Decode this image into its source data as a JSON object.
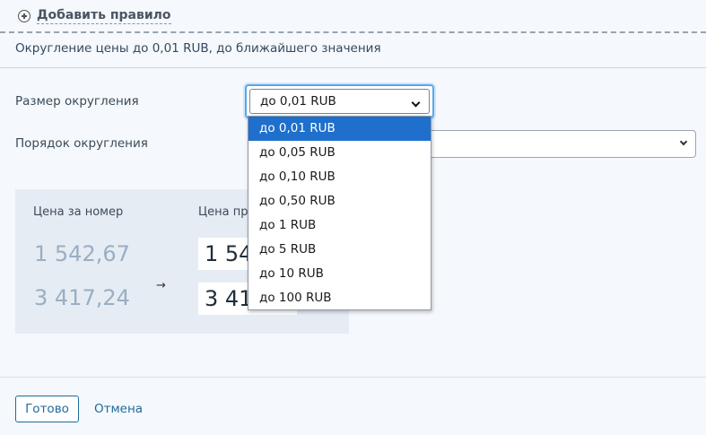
{
  "add_rule": {
    "label": "Добавить правило",
    "icon": "plus-circle-icon"
  },
  "rule_description": "Округление цены до 0,01 RUB, до ближайшего значения",
  "form": {
    "size_label": "Размер округления",
    "size_selected": "до 0,01 RUB",
    "order_label": "Порядок округления",
    "size_options": [
      "до 0,01 RUB",
      "до 0,05 RUB",
      "до 0,10 RUB",
      "до 0,50 RUB",
      "до 1 RUB",
      "до 5 RUB",
      "до 10 RUB",
      "до 100 RUB"
    ],
    "highlighted_option_index": 0
  },
  "preview": {
    "price_header": "Цена за номер",
    "result_header": "Цена пр",
    "original_prices": [
      "1 542,67",
      "3 417,24"
    ],
    "arrow": "→",
    "result_prices": [
      "1 54",
      "3 41"
    ]
  },
  "footer": {
    "done_label": "Готово",
    "cancel_label": "Отмена"
  },
  "colors": {
    "accent": "#1f6a9a",
    "selection": "#1f6fcc",
    "focus_ring": "#5aa7e6"
  }
}
